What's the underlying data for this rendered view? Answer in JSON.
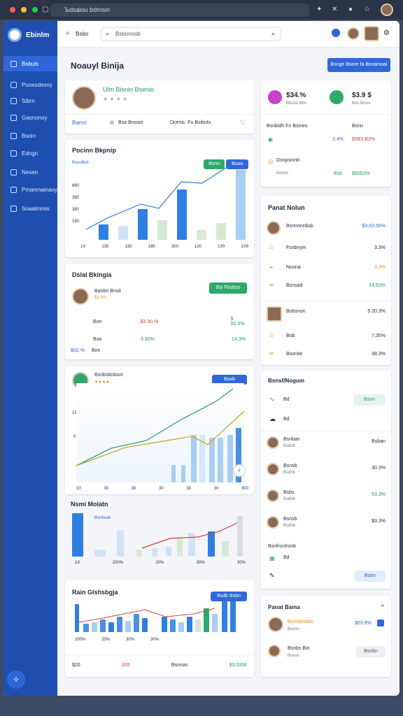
{
  "browser": {
    "url": "Ъdsaiou bdmsin",
    "icons": [
      "close",
      "minimize",
      "maximize"
    ]
  },
  "sidebar": {
    "brand": "Ebinlm",
    "items": [
      {
        "label": "Bsbuls",
        "icon": "grid-icon"
      },
      {
        "label": "Puoesdesvy",
        "icon": "pen-icon"
      },
      {
        "label": "Sibrn",
        "icon": "gear-icon"
      },
      {
        "label": "Gasnonoy",
        "icon": "chat-icon"
      },
      {
        "label": "Bsoin",
        "icon": "file-icon"
      },
      {
        "label": "Edngn",
        "icon": "doc-icon"
      },
      {
        "label": "Nesen",
        "icon": "inbox-icon"
      },
      {
        "label": "Pmanmainaoy",
        "icon": "box-icon"
      },
      {
        "label": "Soaalmmis",
        "icon": "settings-icon"
      }
    ]
  },
  "topbar": {
    "left": "Bsbo",
    "search_placeholder": "Bsbonosb"
  },
  "page": {
    "title": "Noauyl Binija",
    "action_button": "Bsnge Bsore fa Bsnamoal"
  },
  "profile": {
    "name": "Ulm Bisnio Bsenio",
    "stars": "★ ★ ★ ★",
    "link": "Bamn",
    "meta": "Bsa Bnosin",
    "meta2": "Dcenic. Fu Bsibuts"
  },
  "chart1": {
    "title": "Pocinn Bkpnip",
    "subtitle": "Bsoo$ob",
    "legend": [
      "Bsnn",
      "Bsaa"
    ],
    "y": [
      "880",
      "380",
      "380",
      "190"
    ],
    "x": [
      "1X",
      "130",
      "130",
      "180",
      "300",
      "130",
      "130",
      "1X9"
    ]
  },
  "stats": {
    "a": "$34.%",
    "a_sub": "Bbuos Bbs",
    "b": "$3.9 $",
    "b_sub": "Bus Bniss",
    "h1": "Bsnbidh Fn Bsines",
    "h2": "Bsnn",
    "r1": "3.4%",
    "r1b": "$5B3.B3%",
    "r2_name": "Dsnpsinnb",
    "r2_sub": "Bonos",
    "r2a": "Bsb",
    "r2b": "$6053%"
  },
  "partner": {
    "title": "Panat Nolun",
    "list": [
      {
        "name": "Bsnnonnbsb",
        "val": "$3,63.56%"
      },
      {
        "name": "Fsnbnyin",
        "val": "3.3%"
      },
      {
        "name": "Noona",
        "val": "3.3%"
      },
      {
        "name": "Bsnsad",
        "val": "14,63%"
      },
      {
        "name": "Bobsnon",
        "val": "5 20.3%"
      },
      {
        "name": "Bob",
        "val": "7,35%"
      },
      {
        "name": "Bsonite",
        "val": "38.3%"
      }
    ]
  },
  "card2": {
    "title": "Dslal Bkingia",
    "name": "Banbn Bnsit",
    "sub": "$3.3%",
    "btn": "Bsi Fbsbos",
    "rows": [
      {
        "k": "Bon",
        "a": "$3.30.%",
        "b": "$ 02.3%"
      },
      {
        "k": "Bsa",
        "a": "3.90%",
        "b": "14.3%"
      },
      {
        "k": "Bon",
        "a": "",
        "b": ""
      }
    ],
    "foot": "$02.%"
  },
  "card3": {
    "name": "Bsnbsbnbsnt",
    "btn": "Bsab",
    "y": [
      "150",
      "0"
    ],
    "x": [
      "10",
      "30",
      "30",
      "30",
      "30",
      "30",
      "300"
    ]
  },
  "card4": {
    "title": "Nsmi Molatn",
    "sub": "Bsnbsab"
  },
  "card5": {
    "title": "Rain Glshsbgja",
    "btn": "Bsdb Bsbn",
    "x": [
      "1X",
      "200%",
      "20%",
      "30%",
      "30%",
      "30%"
    ],
    "foot": [
      "$20",
      "305",
      "Bsnnan",
      "$3.0356"
    ]
  },
  "panel2": {
    "title": "Bsnsf/Nogum",
    "rows": [
      "Bd",
      "Bd"
    ],
    "btn": "Bsnn",
    "items": [
      {
        "n": "Bsnban",
        "s": "Bsdnb",
        "v": "Bsban"
      },
      {
        "n": "Bsnsb",
        "s": "Bsdnb",
        "v": "30.3%"
      },
      {
        "n": "Bsbs",
        "s": "Bsdnb",
        "v": "53.3%"
      },
      {
        "n": "Bsnsb",
        "s": "Bsdnb",
        "v": "$3.3%"
      }
    ],
    "foot": "Bsnfnsshsnb",
    "foot2": "Bd",
    "foot_btn": "Bsbn"
  },
  "panel3": {
    "title": "Panat Bama",
    "n1": "Bsnnbinbbs",
    "s1": "Bsnsn",
    "v1": "$03.9%",
    "n2": "Bsnbs Bin",
    "s2": "Bsnsn",
    "btn": "Bsnbn"
  },
  "colors": {
    "brand": "#1e4fb0",
    "accent": "#2f67d8",
    "green": "#1f9d55",
    "red": "#d93b3b"
  }
}
